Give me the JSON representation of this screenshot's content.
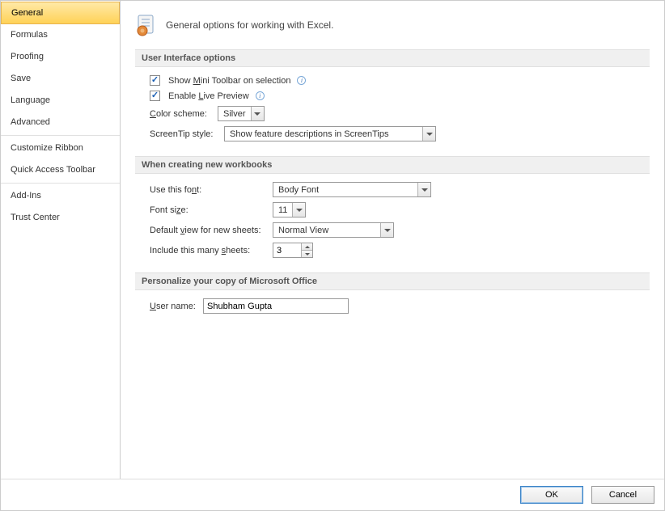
{
  "sidebar": {
    "items": [
      {
        "label": "General",
        "selected": true
      },
      {
        "label": "Formulas"
      },
      {
        "label": "Proofing"
      },
      {
        "label": "Save"
      },
      {
        "label": "Language"
      },
      {
        "label": "Advanced"
      },
      {
        "label": "Customize Ribbon"
      },
      {
        "label": "Quick Access Toolbar"
      },
      {
        "label": "Add-Ins"
      },
      {
        "label": "Trust Center"
      }
    ]
  },
  "header": {
    "text": "General options for working with Excel."
  },
  "sections": {
    "ui": {
      "title": "User Interface options",
      "showMiniToolbar": {
        "checked": true,
        "label_pre": "Show ",
        "label_u": "M",
        "label_post": "ini Toolbar on selection"
      },
      "enableLivePreview": {
        "checked": true,
        "label_pre": "Enable ",
        "label_u": "L",
        "label_post": "ive Preview"
      },
      "colorScheme": {
        "label_u": "C",
        "label_post": "olor scheme:",
        "value": "Silver"
      },
      "screentip": {
        "label": "ScreenTip style:",
        "value": "Show feature descriptions in ScreenTips"
      }
    },
    "newwb": {
      "title": "When creating new workbooks",
      "font": {
        "label_pre": "Use this fo",
        "label_u": "n",
        "label_post": "t:",
        "value": "Body Font"
      },
      "fontSize": {
        "label_pre": "Font si",
        "label_u": "z",
        "label_post": "e:",
        "value": "11"
      },
      "defaultView": {
        "label_pre": "Default ",
        "label_u": "v",
        "label_post": "iew for new sheets:",
        "value": "Normal View"
      },
      "sheetCount": {
        "label_pre": "Include this many ",
        "label_u": "s",
        "label_post": "heets:",
        "value": "3"
      }
    },
    "personalize": {
      "title": "Personalize your copy of Microsoft Office",
      "username": {
        "label_u": "U",
        "label_post": "ser name:",
        "value": "Shubham Gupta"
      }
    }
  },
  "footer": {
    "ok": "OK",
    "cancel": "Cancel"
  }
}
